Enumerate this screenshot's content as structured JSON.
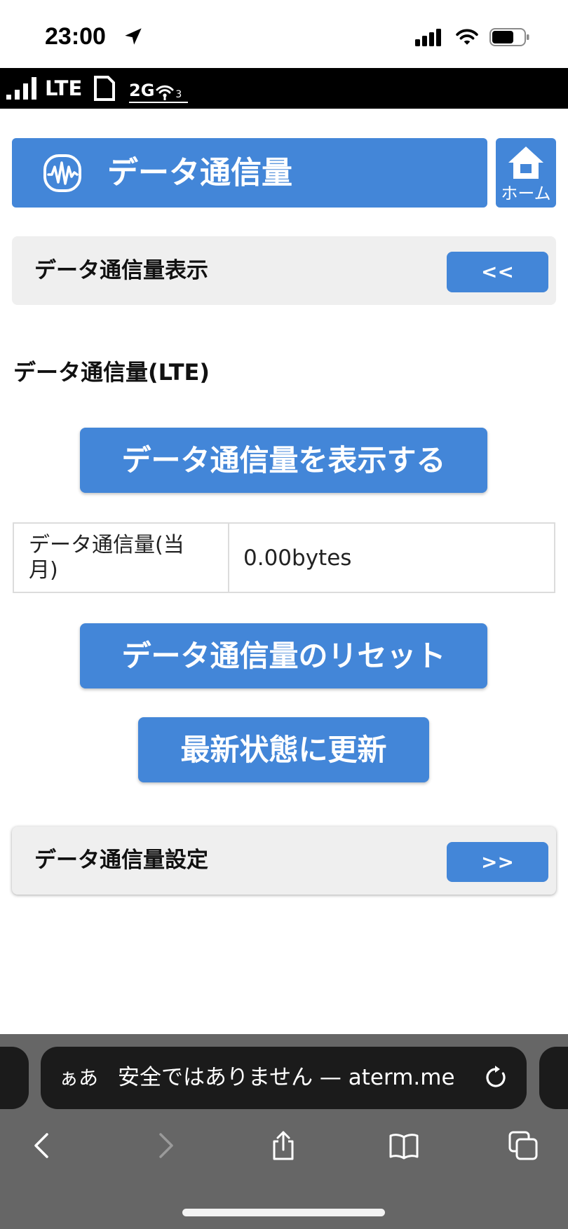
{
  "status_bar": {
    "time": "23:00"
  },
  "router_bar": {
    "network": "LTE",
    "band": "2G",
    "wifi_clients": "3"
  },
  "header": {
    "title": "データ通信量",
    "home_label": "ホーム"
  },
  "display_panel": {
    "title": "データ通信量表示",
    "toggle_label": "<<"
  },
  "lte_section": {
    "title": "データ通信量(LTE)",
    "show_button_label": "データ通信量を表示する",
    "usage_table": [
      {
        "label": "データ通信量(当月)",
        "value": "0.00bytes"
      }
    ],
    "reset_button_label": "データ通信量のリセット",
    "refresh_button_label": "最新状態に更新"
  },
  "settings_panel": {
    "title": "データ通信量設定",
    "toggle_label": ">>"
  },
  "browser": {
    "text_size_label": "ぁあ",
    "address_text": "安全ではありません — aterm.me"
  },
  "icons": {
    "status_location": "location-arrow-icon",
    "status_signal": "cellular-signal-icon",
    "status_wifi": "wifi-icon",
    "status_battery": "battery-icon",
    "router_signal": "router-signal-icon",
    "router_sim": "sim-card-icon",
    "router_wifi": "router-wifi-icon",
    "header": "waveform-icon",
    "home": "home-icon",
    "reload": "reload-icon",
    "back": "back-icon",
    "forward": "forward-icon",
    "share": "share-icon",
    "bookmarks": "bookmarks-icon",
    "tabs": "tabs-icon"
  },
  "colors": {
    "accent": "#4386d8",
    "panel_background": "#efefef",
    "toolbar_background": "#666666",
    "address_pill": "#1b1b1b"
  }
}
